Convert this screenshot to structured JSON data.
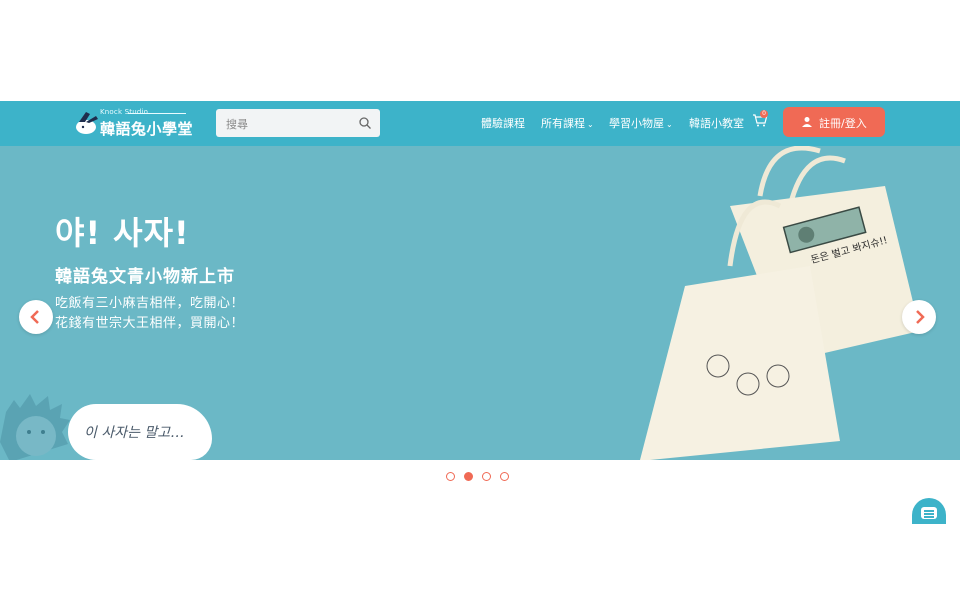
{
  "header": {
    "logo_studio": "Knock Studio",
    "logo_name": "韓語兔小學堂",
    "search_placeholder": "搜尋",
    "nav": [
      {
        "label": "體驗課程"
      },
      {
        "label": "所有課程",
        "chevron": "⌄"
      },
      {
        "label": "學習小物屋",
        "chevron": "⌄"
      },
      {
        "label": "韓語小教室"
      }
    ],
    "cart_count": "0",
    "login_label": "註冊/登入"
  },
  "banner": {
    "headline_kr": "야! 사자!",
    "headline_zh": "韓語兔文青小物新上市",
    "line1": "吃飯有三小麻吉相伴，吃開心！",
    "line2": "花錢有世宗大王相伴，買開心！",
    "bubble_text": "이 사자는 말고…",
    "bag_text": "돈은 벌고 봐지슈!!",
    "prev_icon": "chevron-left",
    "next_icon": "chevron-right"
  },
  "carousel": {
    "slide_count": 4,
    "active_index": 1
  },
  "colors": {
    "topbar": "#3db3c9",
    "banner": "#6bb8c6",
    "accent": "#f06a55"
  }
}
